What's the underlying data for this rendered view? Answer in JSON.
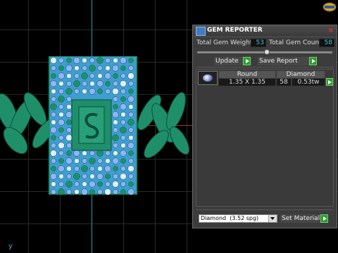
{
  "viewport": {
    "axis_label": "y",
    "colors": {
      "background": "#000000",
      "grid": "#2a2a2a",
      "axis_cyan": "#1aa0b0",
      "model_green": "#1f8f6a",
      "gem_blue": "#8fb3ff"
    }
  },
  "panel": {
    "title": "GEM REPORTER",
    "total_weight_label": "Total Gem Weight",
    "total_weight_value": "53",
    "total_count_label": "Total Gem Count",
    "total_count_value": "58",
    "update_label": "Update",
    "save_report_label": "Save Report",
    "table": {
      "headers": {
        "shape": "Round",
        "material": "Diamond"
      },
      "row": {
        "size": "1.35 X 1.35",
        "count": "58",
        "weight": "0.53tw"
      }
    },
    "material_select": {
      "selected": "Diamond",
      "density": "(3.52 spg)"
    },
    "set_material_label": "Set Material",
    "icons": {
      "app": "gem-reporter-icon",
      "close": "close-icon",
      "go": "play-arrow-icon",
      "thumb": "round-gem-thumbnail"
    }
  }
}
